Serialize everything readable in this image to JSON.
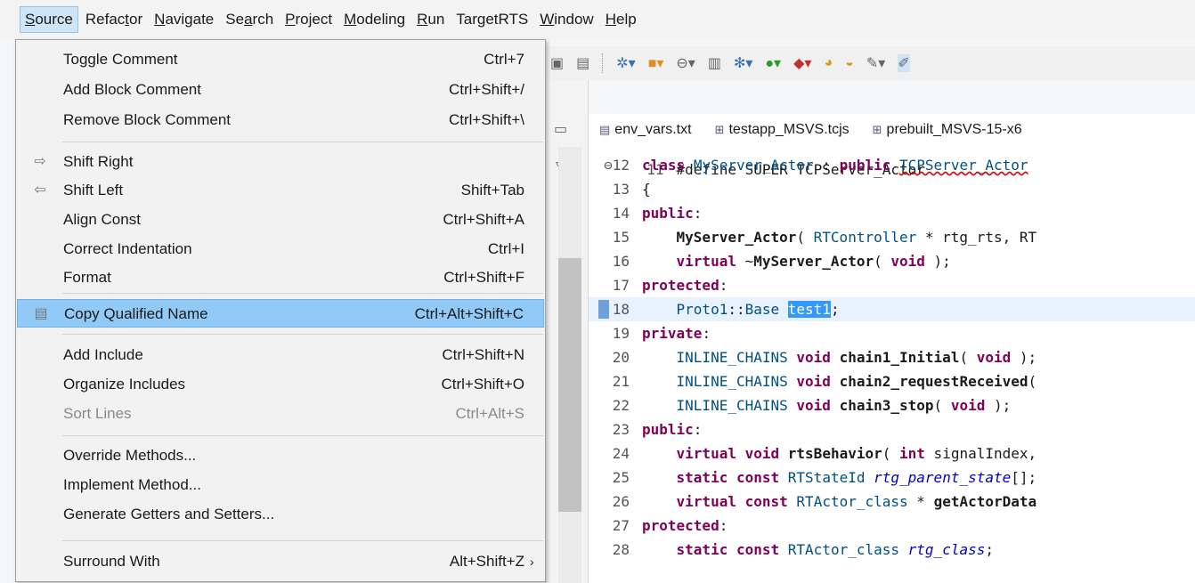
{
  "menubar": [
    {
      "label": "Source",
      "mnemonic": "S",
      "rest": "ource"
    },
    {
      "label": "Refactor",
      "pre": "Refac",
      "mnemonic": "t",
      "rest": "or"
    },
    {
      "label": "Navigate",
      "mnemonic": "N",
      "rest": "avigate"
    },
    {
      "label": "Search",
      "pre": "Se",
      "mnemonic": "a",
      "rest": "rch"
    },
    {
      "label": "Project",
      "mnemonic": "P",
      "rest": "roject"
    },
    {
      "label": "Modeling",
      "mnemonic": "M",
      "rest": "odeling"
    },
    {
      "label": "Run",
      "mnemonic": "R",
      "rest": "un"
    },
    {
      "label": "TargetRTS",
      "pre": "TargetRTS"
    },
    {
      "label": "Window",
      "mnemonic": "W",
      "rest": "indow"
    },
    {
      "label": "Help",
      "mnemonic": "H",
      "rest": "elp"
    }
  ],
  "source_menu": {
    "items": [
      {
        "label": "Toggle Comment",
        "shortcut": "Ctrl+7"
      },
      {
        "label": "Add Block Comment",
        "shortcut": "Ctrl+Shift+/"
      },
      {
        "label": "Remove Block Comment",
        "shortcut": "Ctrl+Shift+\\"
      },
      {
        "label": "Shift Right",
        "shortcut": "",
        "icon": "shift-right-icon"
      },
      {
        "label": "Shift Left",
        "shortcut": "Shift+Tab",
        "icon": "shift-left-icon"
      },
      {
        "label": "Align Const",
        "shortcut": "Ctrl+Shift+A"
      },
      {
        "label": "Correct Indentation",
        "shortcut": "Ctrl+I"
      },
      {
        "label": "Format",
        "shortcut": "Ctrl+Shift+F"
      },
      {
        "label": "Copy Qualified Name",
        "shortcut": "Ctrl+Alt+Shift+C",
        "icon": "copy-qualified-name-icon"
      },
      {
        "label": "Add Include",
        "shortcut": "Ctrl+Shift+N"
      },
      {
        "label": "Organize Includes",
        "shortcut": "Ctrl+Shift+O"
      },
      {
        "label": "Sort Lines",
        "shortcut": "Ctrl+Alt+S"
      },
      {
        "label": "Override Methods...",
        "shortcut": ""
      },
      {
        "label": "Implement Method...",
        "shortcut": ""
      },
      {
        "label": "Generate Getters and Setters...",
        "shortcut": ""
      },
      {
        "label": "Surround With",
        "shortcut": "Alt+Shift+Z"
      }
    ],
    "submenu_arrow": "›",
    "highlighted_item": "Copy Qualified Name",
    "disabled_item": "Sort Lines"
  },
  "editor": {
    "tabs": [
      {
        "label": "env_vars.txt",
        "icon": "text-file-icon"
      },
      {
        "label": "testapp_MSVS.tcjs",
        "icon": "tcjs-file-icon"
      },
      {
        "label": "prebuilt_MSVS-15-x6",
        "icon": "tcjs-file-icon"
      }
    ],
    "partial_top_line": "#define SUPER TCPServer_Actor",
    "lines": [
      {
        "num": "12",
        "text": "class MyServer_Actor : public TCPServer_Actor"
      },
      {
        "num": "13",
        "text": "{"
      },
      {
        "num": "14",
        "text": "public:"
      },
      {
        "num": "15",
        "text": "    MyServer_Actor( RTController * rtg_rts, RT"
      },
      {
        "num": "16",
        "text": "    virtual ~MyServer_Actor( void );"
      },
      {
        "num": "17",
        "text": "protected:"
      },
      {
        "num": "18",
        "text": "    Proto1::Base test1;"
      },
      {
        "num": "19",
        "text": "private:"
      },
      {
        "num": "20",
        "text": "    INLINE_CHAINS void chain1_Initial( void );"
      },
      {
        "num": "21",
        "text": "    INLINE_CHAINS void chain2_requestReceived("
      },
      {
        "num": "22",
        "text": "    INLINE_CHAINS void chain3_stop( void );"
      },
      {
        "num": "23",
        "text": "public:"
      },
      {
        "num": "24",
        "text": "    virtual void rtsBehavior( int signalIndex,"
      },
      {
        "num": "25",
        "text": "    static const RTStateId rtg_parent_state[];"
      },
      {
        "num": "26",
        "text": "    virtual const RTActor_class * getActorData"
      },
      {
        "num": "27",
        "text": "protected:"
      },
      {
        "num": "28",
        "text": "    static const RTActor_class rtg_class;"
      }
    ],
    "current_line": "18",
    "selected_text": "test1"
  },
  "colors": {
    "menu_highlight": "#91c9f7",
    "menubar_active": "#cfe4f7",
    "keyword": "#7f0055",
    "type": "#005080",
    "selection": "#3399ff"
  }
}
